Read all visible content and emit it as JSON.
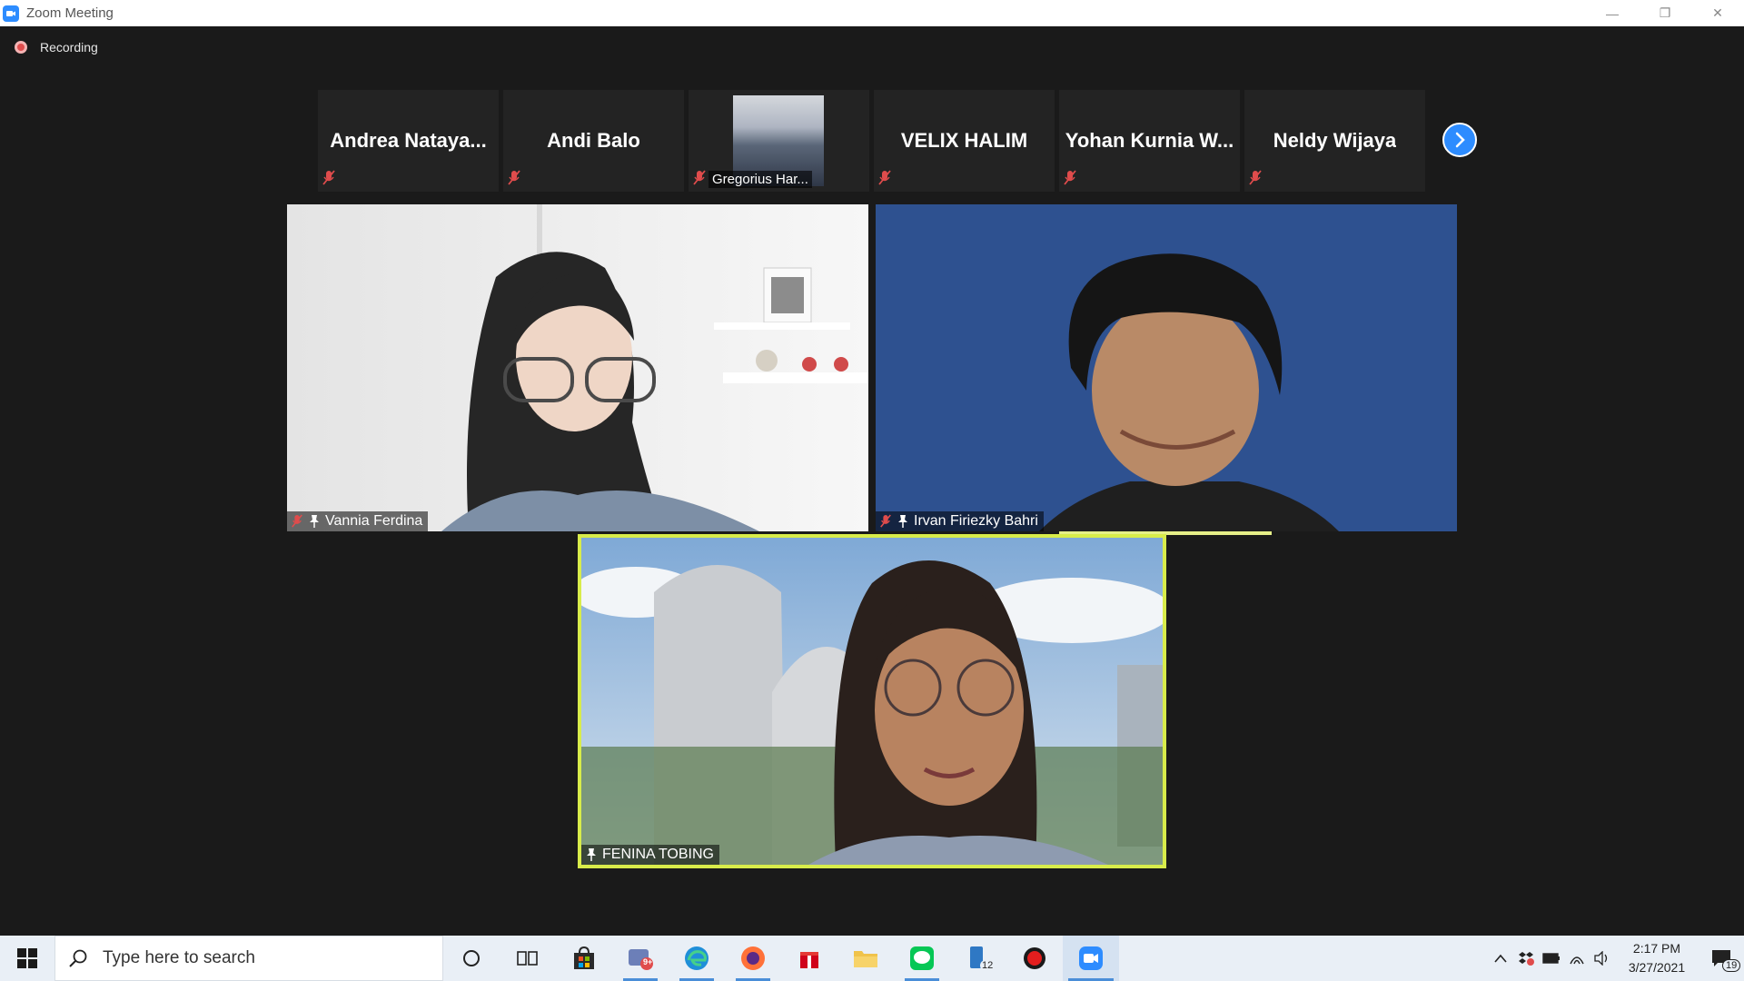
{
  "window": {
    "title": "Zoom Meeting",
    "minimize_glyph": "—",
    "restore_glyph": "❐",
    "close_glyph": "✕"
  },
  "recording": {
    "label": "Recording"
  },
  "thumbnails": [
    {
      "name": "Andrea  Nataya...",
      "muted": true
    },
    {
      "name": "Andi Balo",
      "muted": true
    },
    {
      "name": "Gregorius Har...",
      "muted": true,
      "has_video": true
    },
    {
      "name": "VELIX HALIM",
      "muted": true
    },
    {
      "name": "Yohan  Kurnia  W...",
      "muted": true
    },
    {
      "name": "Neldy Wijaya",
      "muted": true
    }
  ],
  "main_videos": {
    "vannia": {
      "name": "Vannia Ferdina",
      "muted": true,
      "pinned": true
    },
    "irvan": {
      "name": "Irvan Firiezky Bahri",
      "muted": true,
      "pinned": true
    },
    "fenina": {
      "name": "FENINA TOBING",
      "muted": false,
      "pinned": true,
      "active_speaker": true
    }
  },
  "taskbar": {
    "search_placeholder": "Type here to search",
    "apps": [
      "cortana-icon",
      "task-view-icon",
      "store-icon",
      "meet-icon",
      "edge-icon",
      "firefox-icon",
      "gift-icon",
      "file-explorer-icon",
      "line-icon",
      "phone-icon",
      "recorder-icon",
      "zoom-icon"
    ],
    "meet_badge": "9+",
    "phone_badge": "12",
    "time": "2:17 PM",
    "date": "3/27/2021",
    "notification_count": "19"
  },
  "colors": {
    "zoom_blue": "#2d8cff",
    "active_speaker_border": "#d8ec4a",
    "mute_red": "#e04c4c"
  }
}
